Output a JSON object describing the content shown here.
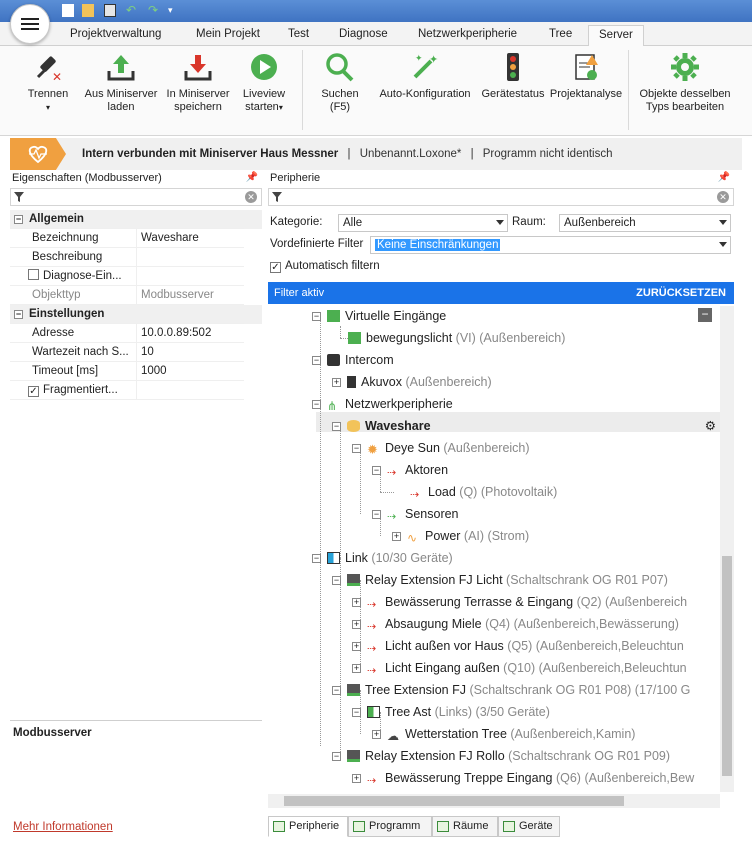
{
  "ribbon_tabs": [
    "Projektverwaltung",
    "Mein Projekt",
    "Test",
    "Diagnose",
    "Netzwerkperipherie",
    "Tree",
    "Server"
  ],
  "active_tab": "Server",
  "ribbon_buttons": [
    {
      "label": "Trennen",
      "icon": "disconnect-plug-icon"
    },
    {
      "label": "Aus Miniserver laden",
      "icon": "upload-arrow-icon"
    },
    {
      "label": "In Miniserver speichern",
      "icon": "download-arrow-icon"
    },
    {
      "label": "Liveview starten",
      "icon": "play-circle-icon"
    },
    {
      "label": "Suchen (F5)",
      "icon": "magnifier-icon"
    },
    {
      "label": "Auto-Konfiguration",
      "icon": "magic-wand-icon"
    },
    {
      "label": "Gerätestatus",
      "icon": "traffic-light-icon"
    },
    {
      "label": "Projektanalyse",
      "icon": "document-warning-icon"
    },
    {
      "label": "Objekte desselben Typs bearbeiten",
      "icon": "gear-icon"
    }
  ],
  "status": {
    "connection": "Intern verbunden mit Miniserver Haus Messner",
    "file": "Unbenannt.Loxone*",
    "program": "Programm nicht identisch"
  },
  "left_panel": {
    "title": "Eigenschaften (Modbusserver)",
    "categories": [
      {
        "name": "Allgemein",
        "rows": [
          {
            "key": "Bezeichnung",
            "value": "Waveshare"
          },
          {
            "key": "Beschreibung",
            "value": ""
          },
          {
            "key": "Diagnose-Ein...",
            "value": "",
            "checkbox": true,
            "checked": false
          },
          {
            "key": "Objekttyp",
            "value": "Modbusserver",
            "dim": true
          }
        ]
      },
      {
        "name": "Einstellungen",
        "rows": [
          {
            "key": "Adresse",
            "value": "10.0.0.89:502"
          },
          {
            "key": "Wartezeit nach S...",
            "value": "10"
          },
          {
            "key": "Timeout [ms]",
            "value": "1000"
          },
          {
            "key": "Fragmentiert...",
            "value": "",
            "checkbox": true,
            "checked": true
          }
        ]
      }
    ],
    "desc_title": "Modbusserver",
    "more_info": "Mehr Informationen"
  },
  "right_panel": {
    "title": "Peripherie",
    "kategorie_label": "Kategorie:",
    "kategorie_value": "Alle",
    "raum_label": "Raum:",
    "raum_value": "Außenbereich",
    "filter_label": "Vordefinierte Filter",
    "filter_value": "Keine Einschränkungen",
    "auto_filter": "Automatisch filtern",
    "filter_active": "Filter aktiv",
    "reset": "ZURÜCKSETZEN"
  },
  "tree": [
    {
      "name": "Virtuelle Eingänge",
      "extra": ""
    },
    {
      "name": "bewegungslicht",
      "extra": "(VI) (Außenbereich)"
    },
    {
      "name": "Intercom",
      "extra": ""
    },
    {
      "name": "Akuvox",
      "extra": "(Außenbereich)"
    },
    {
      "name": "Netzwerkperipherie",
      "extra": ""
    },
    {
      "name": "Waveshare",
      "extra": ""
    },
    {
      "name": "Deye Sun",
      "extra": "(Außenbereich)"
    },
    {
      "name": "Aktoren",
      "extra": ""
    },
    {
      "name": "Load",
      "extra": "(Q) (Photovoltaik)"
    },
    {
      "name": "Sensoren",
      "extra": ""
    },
    {
      "name": "Power",
      "extra": "(AI) (Strom)"
    },
    {
      "name": "Link",
      "extra": "(10/30 Geräte)"
    },
    {
      "name": "Relay Extension FJ Licht",
      "extra": "(Schaltschrank OG R01 P07)"
    },
    {
      "name": "Bewässerung Terrasse & Eingang",
      "extra": "(Q2) (Außenbereich"
    },
    {
      "name": "Absaugung Miele",
      "extra": "(Q4) (Außenbereich,Bewässerung)"
    },
    {
      "name": "Licht außen vor Haus",
      "extra": "(Q5) (Außenbereich,Beleuchtun"
    },
    {
      "name": "Licht Eingang außen",
      "extra": "(Q10) (Außenbereich,Beleuchtun"
    },
    {
      "name": "Tree Extension FJ",
      "extra": "(Schaltschrank OG R01 P08) (17/100 G"
    },
    {
      "name": "Tree Ast",
      "extra": "(Links) (3/50 Geräte)"
    },
    {
      "name": "Wetterstation Tree",
      "extra": "(Außenbereich,Kamin)"
    },
    {
      "name": "Relay Extension FJ Rollo",
      "extra": "(Schaltschrank OG R01 P09)"
    },
    {
      "name": "Bewässerung Treppe Eingang",
      "extra": "(Q6) (Außenbereich,Bew"
    }
  ],
  "bottom_tabs": [
    "Peripherie",
    "Programm",
    "Räume",
    "Geräte"
  ],
  "colors": {
    "accent": "#1a73e8",
    "status_orange": "#f0a040",
    "green": "#5cb85c",
    "red": "#d9362b"
  }
}
